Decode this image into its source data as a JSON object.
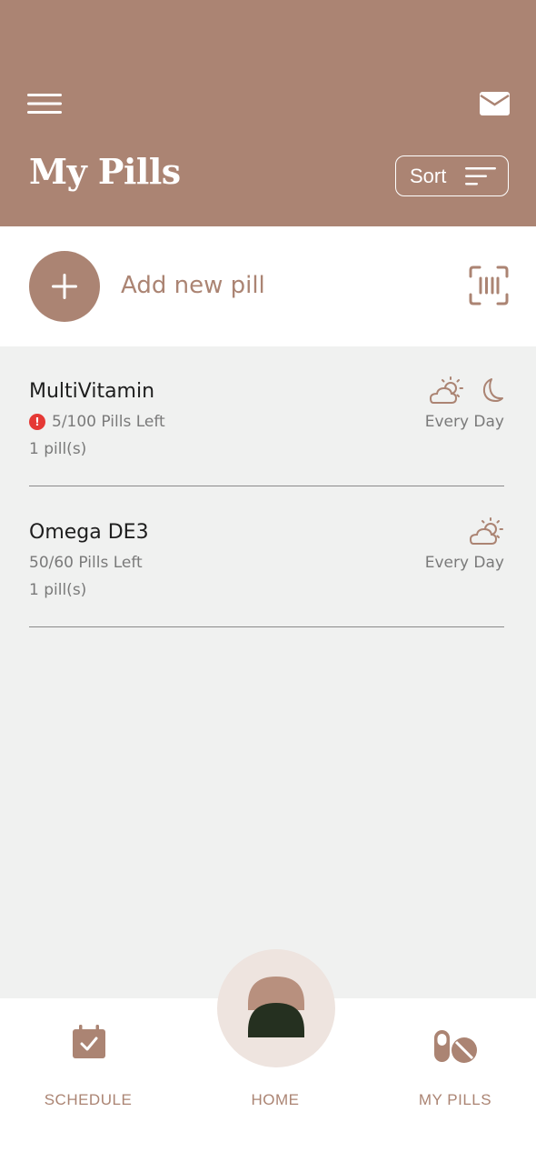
{
  "header": {
    "title": "My Pills",
    "sort_label": "Sort",
    "menu_icon": "hamburger-menu-icon",
    "mail_icon": "envelope-icon",
    "background": "#ab8473"
  },
  "add_row": {
    "label": "Add new pill",
    "add_icon": "plus-icon",
    "scan_icon": "barcode-scan-icon"
  },
  "pills": [
    {
      "name": "MultiVitamin",
      "pills_left": "5/100 Pills Left",
      "low_stock_warning": true,
      "dose": "1 pill(s)",
      "frequency": "Every Day",
      "times": [
        "sun-cloud-icon",
        "moon-icon"
      ]
    },
    {
      "name": "Omega DE3",
      "pills_left": "50/60 Pills Left",
      "low_stock_warning": false,
      "dose": "1 pill(s)",
      "frequency": "Every Day",
      "times": [
        "sun-cloud-icon"
      ]
    }
  ],
  "nav": {
    "schedule": "SCHEDULE",
    "home": "HOME",
    "my_pills": "MY PILLS"
  },
  "colors": {
    "accent": "#ab8473",
    "warning": "#e53935",
    "list_background": "#f0f1f0",
    "home_circle": "#eee4df",
    "home_dark": "#253020"
  }
}
